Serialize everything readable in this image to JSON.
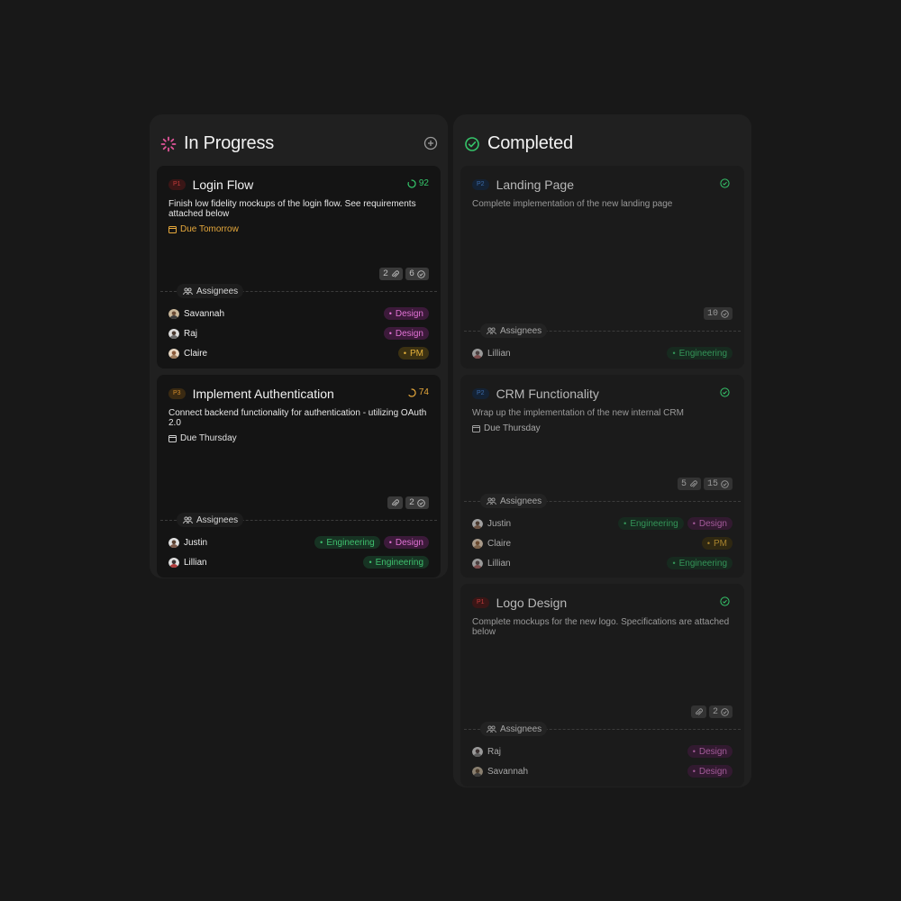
{
  "columns": {
    "in_progress": {
      "title": "In Progress",
      "cards": [
        {
          "priority": "P1",
          "title": "Login Flow",
          "progress": "92",
          "description": "Finish low fidelity mockups of the login flow. See requirements attached below",
          "due": "Due Tomorrow",
          "attachments": "2",
          "tasks": "6",
          "assignees_label": "Assignees",
          "people": [
            {
              "name": "Savannah",
              "tags": [
                "Design"
              ]
            },
            {
              "name": "Raj",
              "tags": [
                "Design"
              ]
            },
            {
              "name": "Claire",
              "tags": [
                "PM"
              ]
            }
          ]
        },
        {
          "priority": "P3",
          "title": "Implement Authentication",
          "progress": "74",
          "description": "Connect backend functionality for authentication - utilizing OAuth 2.0",
          "due": "Due Thursday",
          "tasks": "2",
          "assignees_label": "Assignees",
          "people": [
            {
              "name": "Justin",
              "tags": [
                "Engineering",
                "Design"
              ]
            },
            {
              "name": "Lillian",
              "tags": [
                "Engineering"
              ]
            }
          ]
        }
      ]
    },
    "completed": {
      "title": "Completed",
      "cards": [
        {
          "priority": "P2",
          "title": "Landing Page",
          "description": "Complete implementation of the new landing page",
          "tasks": "10",
          "assignees_label": "Assignees",
          "people": [
            {
              "name": "Lillian",
              "tags": [
                "Engineering"
              ]
            }
          ]
        },
        {
          "priority": "P2",
          "title": "CRM Functionality",
          "description": "Wrap up the implementation of the new internal CRM",
          "due": "Due Thursday",
          "attachments": "5",
          "tasks": "15",
          "assignees_label": "Assignees",
          "people": [
            {
              "name": "Justin",
              "tags": [
                "Engineering",
                "Design"
              ]
            },
            {
              "name": "Claire",
              "tags": [
                "PM"
              ]
            },
            {
              "name": "Lillian",
              "tags": [
                "Engineering"
              ]
            }
          ]
        },
        {
          "priority": "P1",
          "title": "Logo Design",
          "description": "Complete mockups for the new logo. Specifications are attached below",
          "tasks": "2",
          "assignees_label": "Assignees",
          "people": [
            {
              "name": "Raj",
              "tags": [
                "Design"
              ]
            },
            {
              "name": "Savannah",
              "tags": [
                "Design"
              ]
            }
          ]
        }
      ]
    }
  },
  "colors": {
    "in_progress_icon": "#e2559a",
    "completed_icon": "#35c46a",
    "warning": "#e6a83b",
    "design": "#e072d4",
    "engineering": "#3fbf6e",
    "pm": "#e6b23b"
  }
}
